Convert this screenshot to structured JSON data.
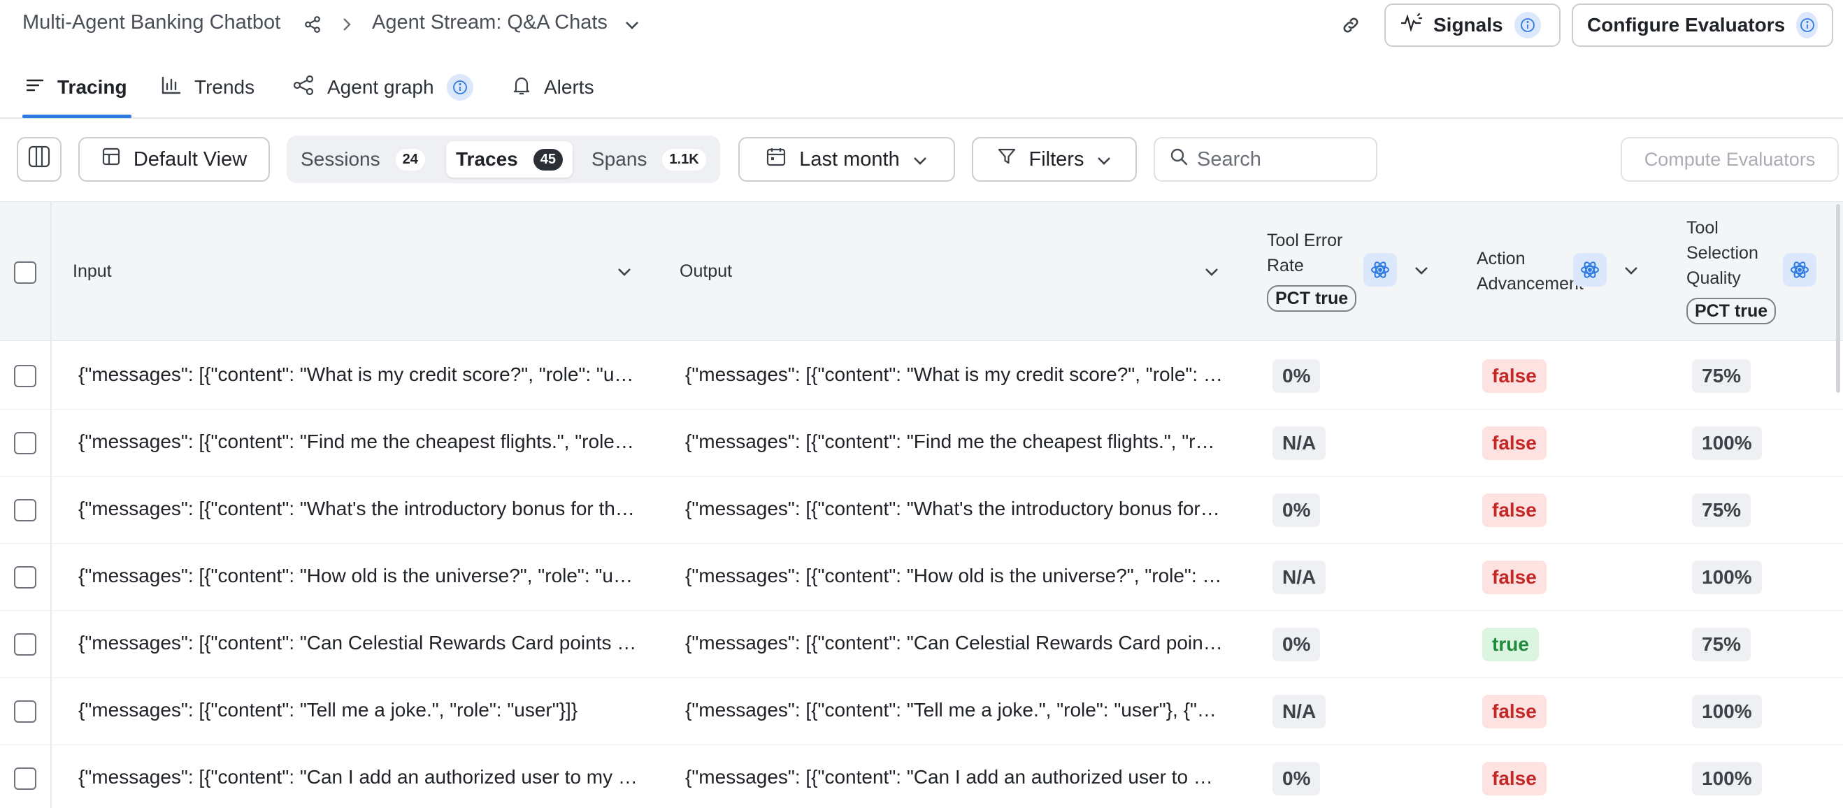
{
  "breadcrumb": {
    "project": "Multi-Agent Banking Chatbot",
    "stream": "Agent Stream: Q&A Chats"
  },
  "header_buttons": {
    "signals": "Signals",
    "configure": "Configure Evaluators"
  },
  "tabs": [
    {
      "label": "Tracing",
      "active": true
    },
    {
      "label": "Trends",
      "active": false
    },
    {
      "label": "Agent graph",
      "active": false
    },
    {
      "label": "Alerts",
      "active": false
    }
  ],
  "toolbar": {
    "view": "Default View",
    "segments": [
      {
        "label": "Sessions",
        "count": "24",
        "active": false
      },
      {
        "label": "Traces",
        "count": "45",
        "active": true
      },
      {
        "label": "Spans",
        "count": "1.1K",
        "active": false
      }
    ],
    "date_range": "Last month",
    "filters": "Filters",
    "search_placeholder": "Search",
    "compute": "Compute Evaluators"
  },
  "table": {
    "columns": {
      "input": "Input",
      "output": "Output",
      "tool_error_rate": "Tool Error Rate",
      "tool_error_rate_agg": "PCT true",
      "action_advancement": "Action Advancement",
      "tool_selection_quality": "Tool Selection Quality",
      "tool_selection_quality_agg": "PCT true"
    },
    "rows": [
      {
        "input": "{\"messages\": [{\"content\": \"What is my credit score?\", \"role\": \"user\"}]}",
        "output": "{\"messages\": [{\"content\": \"What is my credit score?\", \"role\": \"user\"}, {\"content\": \"\"}]}",
        "tool_error_rate": "0%",
        "action_advancement": "false",
        "tool_selection_quality": "75%"
      },
      {
        "input": "{\"messages\": [{\"content\": \"Find me the cheapest flights.\", \"role\": \"user\"}]}",
        "output": "{\"messages\": [{\"content\": \"Find me the cheapest flights.\", \"role\": \"user\"}]}",
        "tool_error_rate": "N/A",
        "action_advancement": "false",
        "tool_selection_quality": "100%"
      },
      {
        "input": "{\"messages\": [{\"content\": \"What's the introductory bonus for the card?\"}]}",
        "output": "{\"messages\": [{\"content\": \"What's the introductory bonus for the card?\"}]}",
        "tool_error_rate": "0%",
        "action_advancement": "false",
        "tool_selection_quality": "75%"
      },
      {
        "input": "{\"messages\": [{\"content\": \"How old is the universe?\", \"role\": \"user\"}]}",
        "output": "{\"messages\": [{\"content\": \"How old is the universe?\", \"role\": \"user\"}]}",
        "tool_error_rate": "N/A",
        "action_advancement": "false",
        "tool_selection_quality": "100%"
      },
      {
        "input": "{\"messages\": [{\"content\": \"Can Celestial Rewards Card points be transferred?\"}]}",
        "output": "{\"messages\": [{\"content\": \"Can Celestial Rewards Card points be transferred?\"}]}",
        "tool_error_rate": "0%",
        "action_advancement": "true",
        "tool_selection_quality": "75%"
      },
      {
        "input": "{\"messages\": [{\"content\": \"Tell me a joke.\", \"role\": \"user\"}]}",
        "output": "{\"messages\": [{\"content\": \"Tell me a joke.\", \"role\": \"user\"}, {\"content\": \"\"}]}",
        "tool_error_rate": "N/A",
        "action_advancement": "false",
        "tool_selection_quality": "100%"
      },
      {
        "input": "{\"messages\": [{\"content\": \"Can I add an authorized user to my account?\"}]}",
        "output": "{\"messages\": [{\"content\": \"Can I add an authorized user to my account?\"}]}",
        "tool_error_rate": "0%",
        "action_advancement": "false",
        "tool_selection_quality": "100%"
      }
    ]
  },
  "colors": {
    "accent": "#2f7ae0",
    "false_bg": "#fde2e2",
    "false_text": "#c62828",
    "true_bg": "#dcf5e0",
    "true_text": "#1e8a3c"
  }
}
